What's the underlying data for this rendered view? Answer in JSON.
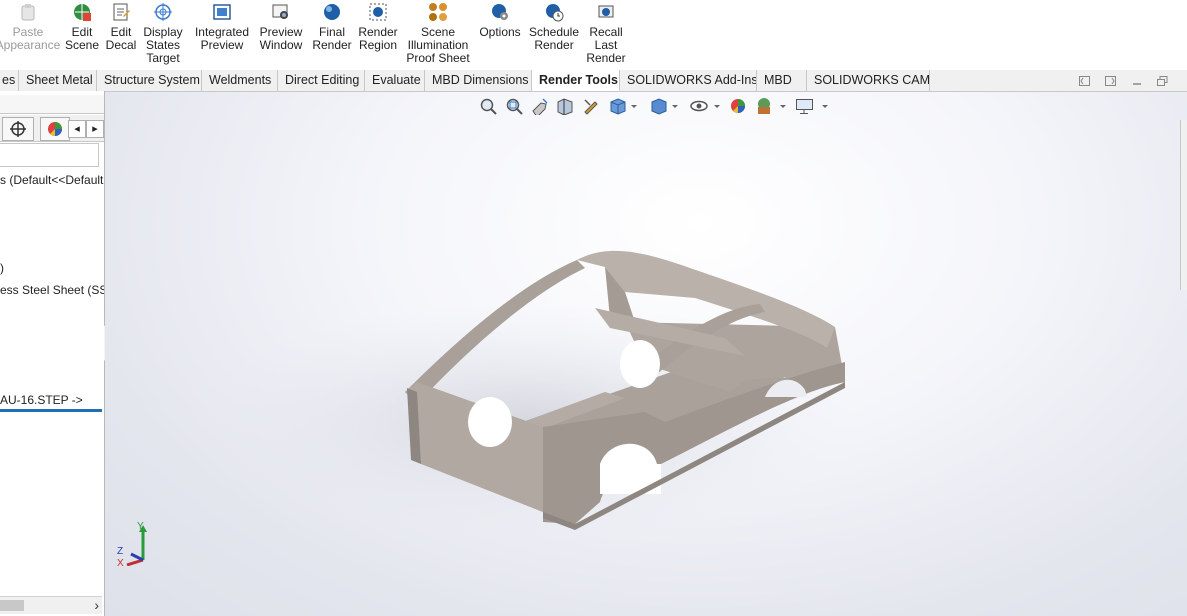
{
  "ribbon": {
    "buttons": [
      {
        "label": "Paste\nAppearance",
        "icon": "paste-appearance-icon",
        "enabled": false
      },
      {
        "label": "Edit\nScene",
        "icon": "edit-scene-icon",
        "enabled": true
      },
      {
        "label": "Edit\nDecal",
        "icon": "edit-decal-icon",
        "enabled": true
      },
      {
        "label": "Display\nStates\nTarget",
        "icon": "display-states-target-icon",
        "enabled": true
      },
      {
        "label": "Integrated\nPreview",
        "icon": "integrated-preview-icon",
        "enabled": true
      },
      {
        "label": "Preview\nWindow",
        "icon": "preview-window-icon",
        "enabled": true
      },
      {
        "label": "Final\nRender",
        "icon": "final-render-icon",
        "enabled": true
      },
      {
        "label": "Render\nRegion",
        "icon": "render-region-icon",
        "enabled": true
      },
      {
        "label": "Scene\nIllumination\nProof Sheet",
        "icon": "scene-illumination-icon",
        "enabled": true
      },
      {
        "label": "Options",
        "icon": "options-icon",
        "enabled": true
      },
      {
        "label": "Schedule\nRender",
        "icon": "schedule-render-icon",
        "enabled": true
      },
      {
        "label": "Recall\nLast\nRender",
        "icon": "recall-last-render-icon",
        "enabled": true
      }
    ]
  },
  "tabs": [
    {
      "label": "es",
      "active": false
    },
    {
      "label": "Sheet Metal",
      "active": false
    },
    {
      "label": "Structure System",
      "active": false
    },
    {
      "label": "Weldments",
      "active": false
    },
    {
      "label": "Direct Editing",
      "active": false
    },
    {
      "label": "Evaluate",
      "active": false
    },
    {
      "label": "MBD Dimensions",
      "active": false
    },
    {
      "label": "Render Tools",
      "active": true
    },
    {
      "label": "SOLIDWORKS Add-Ins",
      "active": false
    },
    {
      "label": "MBD",
      "active": false
    },
    {
      "label": "SOLIDWORKS CAM",
      "active": false
    }
  ],
  "feature_tree": {
    "config_text": "s  (Default<<Default",
    "paren_text": ")",
    "material_text": "ess Steel Sheet (SS)",
    "file_text": "AU-16.STEP ->",
    "arrow_left": "◂",
    "arrow_right": "▸",
    "scroll_right": "›"
  },
  "view_toolbar": {
    "icons": [
      "zoom-to-fit-icon",
      "zoom-to-area-icon",
      "previous-view-icon",
      "section-view-icon",
      "dynamic-annotation-icon",
      "view-orientation-icon",
      "display-style-icon",
      "hide-show-icon",
      "edit-appearance-icon",
      "apply-scene-icon",
      "view-settings-icon"
    ]
  },
  "triad": {
    "x_label": "X",
    "y_label": "Y",
    "z_label": "Z"
  },
  "colors": {
    "model": "#b8b0a8",
    "model_dark": "#8e8680",
    "accent": "#1f6fb5"
  }
}
